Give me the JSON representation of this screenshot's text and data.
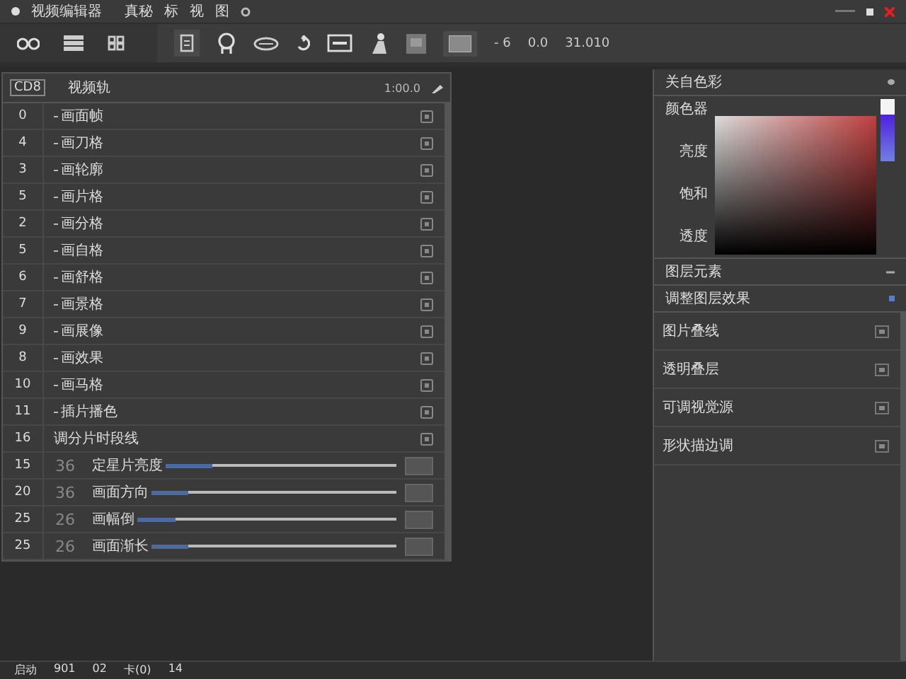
{
  "window": {
    "title": "视频编辑器",
    "menu": [
      "真秘",
      "标",
      "视",
      "图"
    ]
  },
  "toolbar": {
    "readouts": [
      "- 6",
      "0.0",
      "31.010"
    ]
  },
  "track_panel": {
    "code": "CD8",
    "title": "视频轨",
    "time": "1:00.0",
    "rows": [
      {
        "kind": "plain",
        "number": "0",
        "label": "画面帧",
        "bullet": true
      },
      {
        "kind": "plain",
        "number": "4",
        "label": "画刀格",
        "bullet": true
      },
      {
        "kind": "plain",
        "number": "3",
        "label": "画轮廓",
        "bullet": true
      },
      {
        "kind": "plain",
        "number": "5",
        "label": "画片格",
        "bullet": true
      },
      {
        "kind": "plain",
        "number": "2",
        "label": "画分格",
        "bullet": true
      },
      {
        "kind": "plain",
        "number": "5",
        "label": "画自格",
        "bullet": true
      },
      {
        "kind": "plain",
        "number": "6",
        "label": "画舒格",
        "bullet": true
      },
      {
        "kind": "plain",
        "number": "7",
        "label": "画景格",
        "bullet": true
      },
      {
        "kind": "plain",
        "number": "9",
        "label": "画展像",
        "bullet": true
      },
      {
        "kind": "plain",
        "number": "8",
        "label": "画效果",
        "bullet": true
      },
      {
        "kind": "plain",
        "number": "10",
        "label": "画马格",
        "bullet": true
      },
      {
        "kind": "plain",
        "number": "11",
        "label": "插片播色",
        "bullet": true
      },
      {
        "kind": "plain",
        "number": "16",
        "label": "调分片时段线",
        "bullet": false
      },
      {
        "kind": "slider",
        "number": "15",
        "value": "36",
        "label": "定星片亮度",
        "level": 0.2
      },
      {
        "kind": "slider",
        "number": "20",
        "value": "36",
        "label": "画面方向",
        "level": 0.15
      },
      {
        "kind": "slider",
        "number": "25",
        "value": "26",
        "label": "画幅倒",
        "level": 0.15
      },
      {
        "kind": "slider",
        "number": "25",
        "value": "26",
        "label": "画面渐长",
        "level": 0.15
      }
    ]
  },
  "color_panel": {
    "title": "关自色彩",
    "picker_label": "颜色器",
    "channels": [
      "亮度",
      "饱和",
      "透度"
    ],
    "section": "图层元素",
    "subsection": "调整图层效果",
    "items": [
      "图片叠线",
      "透明叠层",
      "可调视觉源",
      "形状描边调"
    ]
  },
  "status_bar": [
    "启动",
    "901",
    "02",
    "卡(0)",
    "14"
  ]
}
